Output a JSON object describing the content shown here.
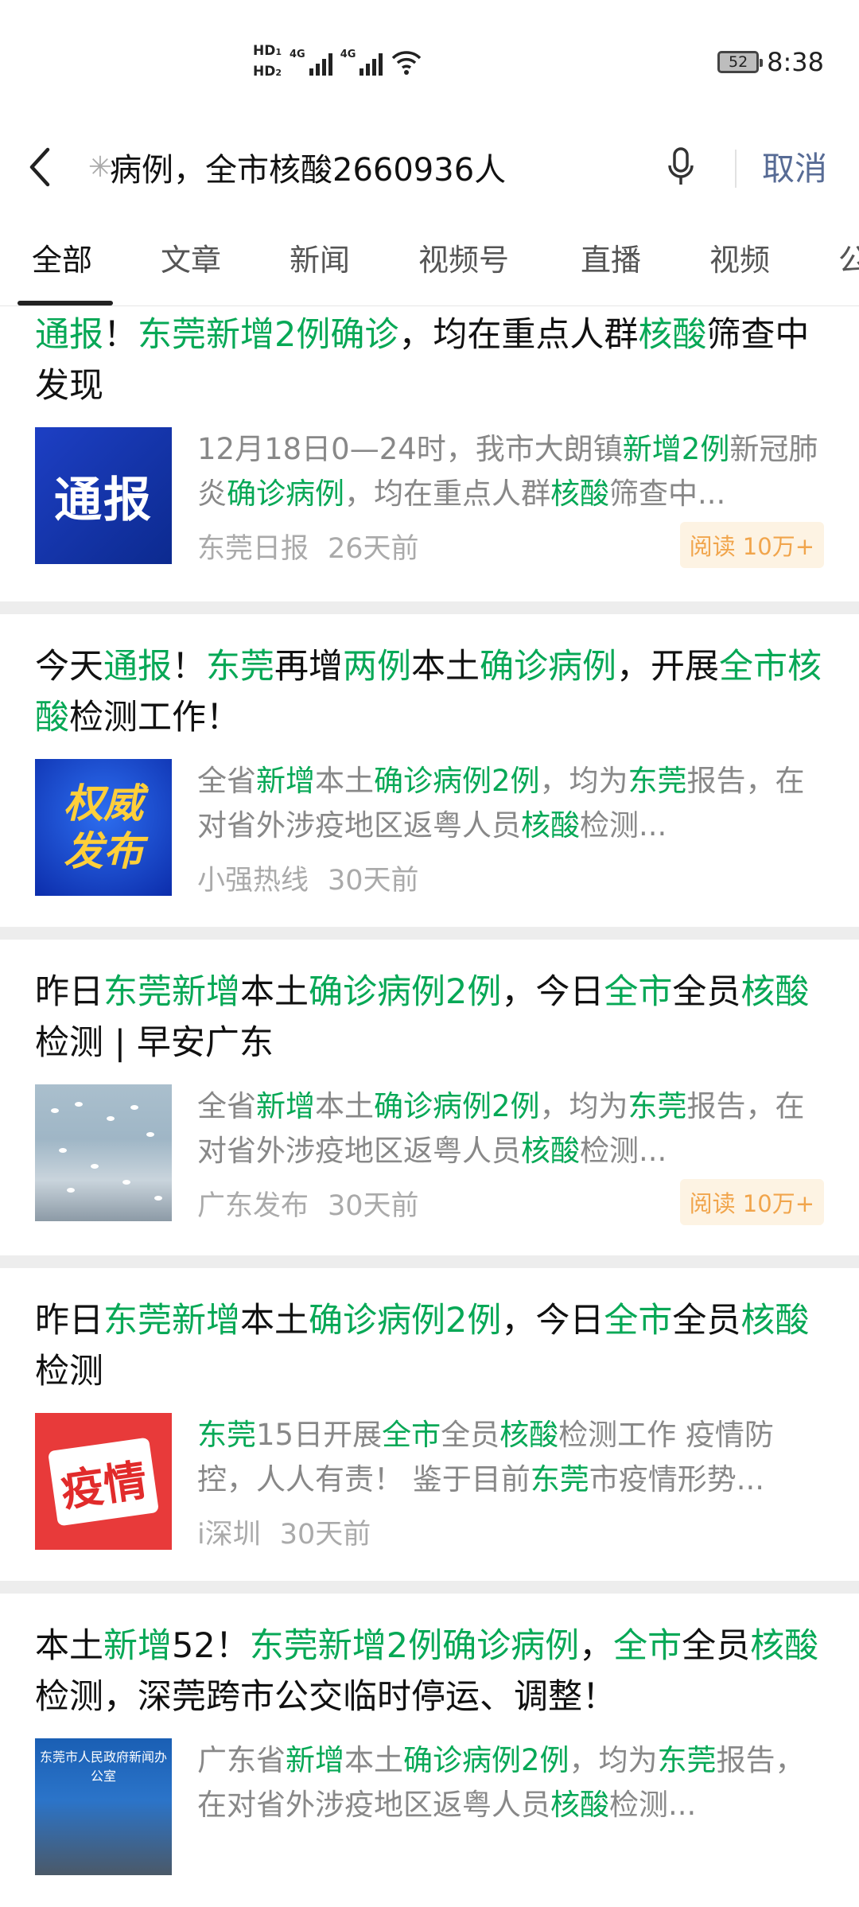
{
  "status_bar": {
    "sim1": "HD",
    "sim1_num": "1",
    "sim2": "HD",
    "sim2_num": "2",
    "net1": "4G",
    "net2": "4G",
    "battery": "52",
    "time": "8:38"
  },
  "search": {
    "query": "病例，全市核酸2660936人",
    "cancel_label": "取消"
  },
  "tabs": [
    {
      "label": "全部"
    },
    {
      "label": "文章"
    },
    {
      "label": "新闻"
    },
    {
      "label": "视频号"
    },
    {
      "label": "直播"
    },
    {
      "label": "视频"
    },
    {
      "label": "公"
    }
  ],
  "results": [
    {
      "title": [
        [
          "通报",
          true
        ],
        [
          "！",
          false
        ],
        [
          "东莞新增2例确诊",
          true
        ],
        [
          "，均在重点人群",
          false
        ],
        [
          "核酸",
          true
        ],
        [
          "筛查中发现",
          false
        ]
      ],
      "desc": [
        [
          "12月18日0—24时，我市大朗镇",
          false
        ],
        [
          "新增2例",
          true
        ],
        [
          "新冠肺炎",
          false
        ],
        [
          "确诊病例",
          true
        ],
        [
          "，均在重点人群",
          false
        ],
        [
          "核酸",
          true
        ],
        [
          "筛查中...",
          false
        ]
      ],
      "thumb_text": "通报",
      "source": "东莞日报",
      "time": "26天前",
      "read": "阅读 10万+"
    },
    {
      "title": [
        [
          "今天",
          false
        ],
        [
          "通报",
          true
        ],
        [
          "！",
          false
        ],
        [
          "东莞",
          true
        ],
        [
          "再增",
          false
        ],
        [
          "两例",
          true
        ],
        [
          "本土",
          false
        ],
        [
          "确诊病例",
          true
        ],
        [
          "，开展",
          false
        ],
        [
          "全市核酸",
          true
        ],
        [
          "检测工作！",
          false
        ]
      ],
      "desc": [
        [
          "全省",
          false
        ],
        [
          "新增",
          true
        ],
        [
          "本土",
          false
        ],
        [
          "确诊病例2例",
          true
        ],
        [
          "，均为",
          false
        ],
        [
          "东莞",
          true
        ],
        [
          "报告，在对省外涉疫地区返粤人员",
          false
        ],
        [
          "核酸",
          true
        ],
        [
          "检测...",
          false
        ]
      ],
      "thumb_text": "权威",
      "thumb_text2": "发布",
      "source": "小强热线",
      "time": "30天前",
      "read": ""
    },
    {
      "title": [
        [
          "昨日",
          false
        ],
        [
          "东莞新增",
          true
        ],
        [
          "本土",
          false
        ],
        [
          "确诊病例2例",
          true
        ],
        [
          "，今日",
          false
        ],
        [
          "全市",
          true
        ],
        [
          "全员",
          false
        ],
        [
          "核酸",
          true
        ],
        [
          "检测 | 早安广东",
          false
        ]
      ],
      "desc": [
        [
          "全省",
          false
        ],
        [
          "新增",
          true
        ],
        [
          "本土",
          false
        ],
        [
          "确诊病例2例",
          true
        ],
        [
          "，均为",
          false
        ],
        [
          "东莞",
          true
        ],
        [
          "报告，在对省外涉疫地区返粤人员",
          false
        ],
        [
          "核酸",
          true
        ],
        [
          "检测...",
          false
        ]
      ],
      "source": "广东发布",
      "time": "30天前",
      "read": "阅读 10万+"
    },
    {
      "title": [
        [
          "昨日",
          false
        ],
        [
          "东莞新增",
          true
        ],
        [
          "本土",
          false
        ],
        [
          "确诊病例2例",
          true
        ],
        [
          "，今日",
          false
        ],
        [
          "全市",
          true
        ],
        [
          "全员",
          false
        ],
        [
          "核酸",
          true
        ],
        [
          "检测",
          false
        ]
      ],
      "desc": [
        [
          "东莞",
          true
        ],
        [
          "15日开展",
          false
        ],
        [
          "全市",
          true
        ],
        [
          "全员",
          false
        ],
        [
          "核酸",
          true
        ],
        [
          "检测工作 疫情防控，人人有责！ 鉴于目前",
          false
        ],
        [
          "东莞",
          true
        ],
        [
          "市疫情形势...",
          false
        ]
      ],
      "thumb_text": "疫情",
      "source": "i深圳",
      "time": "30天前",
      "read": ""
    },
    {
      "title": [
        [
          "本土",
          false
        ],
        [
          "新增",
          true
        ],
        [
          "52！",
          false
        ],
        [
          "东莞新增2例确诊病例",
          true
        ],
        [
          "，",
          false
        ],
        [
          "全市",
          true
        ],
        [
          "全员",
          false
        ],
        [
          "核酸",
          true
        ],
        [
          "检测，深莞跨市公交临时停运、调整！",
          false
        ]
      ],
      "desc": [
        [
          "广东省",
          false
        ],
        [
          "新增",
          true
        ],
        [
          "本土",
          false
        ],
        [
          "确诊病例2例",
          true
        ],
        [
          "，均为",
          false
        ],
        [
          "东莞",
          true
        ],
        [
          "报告，在对省外涉疫地区返粤人员",
          false
        ],
        [
          "核酸",
          true
        ],
        [
          "检测...",
          false
        ]
      ],
      "thumb_text": "东莞市人民政府新闻办公室",
      "source": "",
      "time": "",
      "read": ""
    }
  ]
}
